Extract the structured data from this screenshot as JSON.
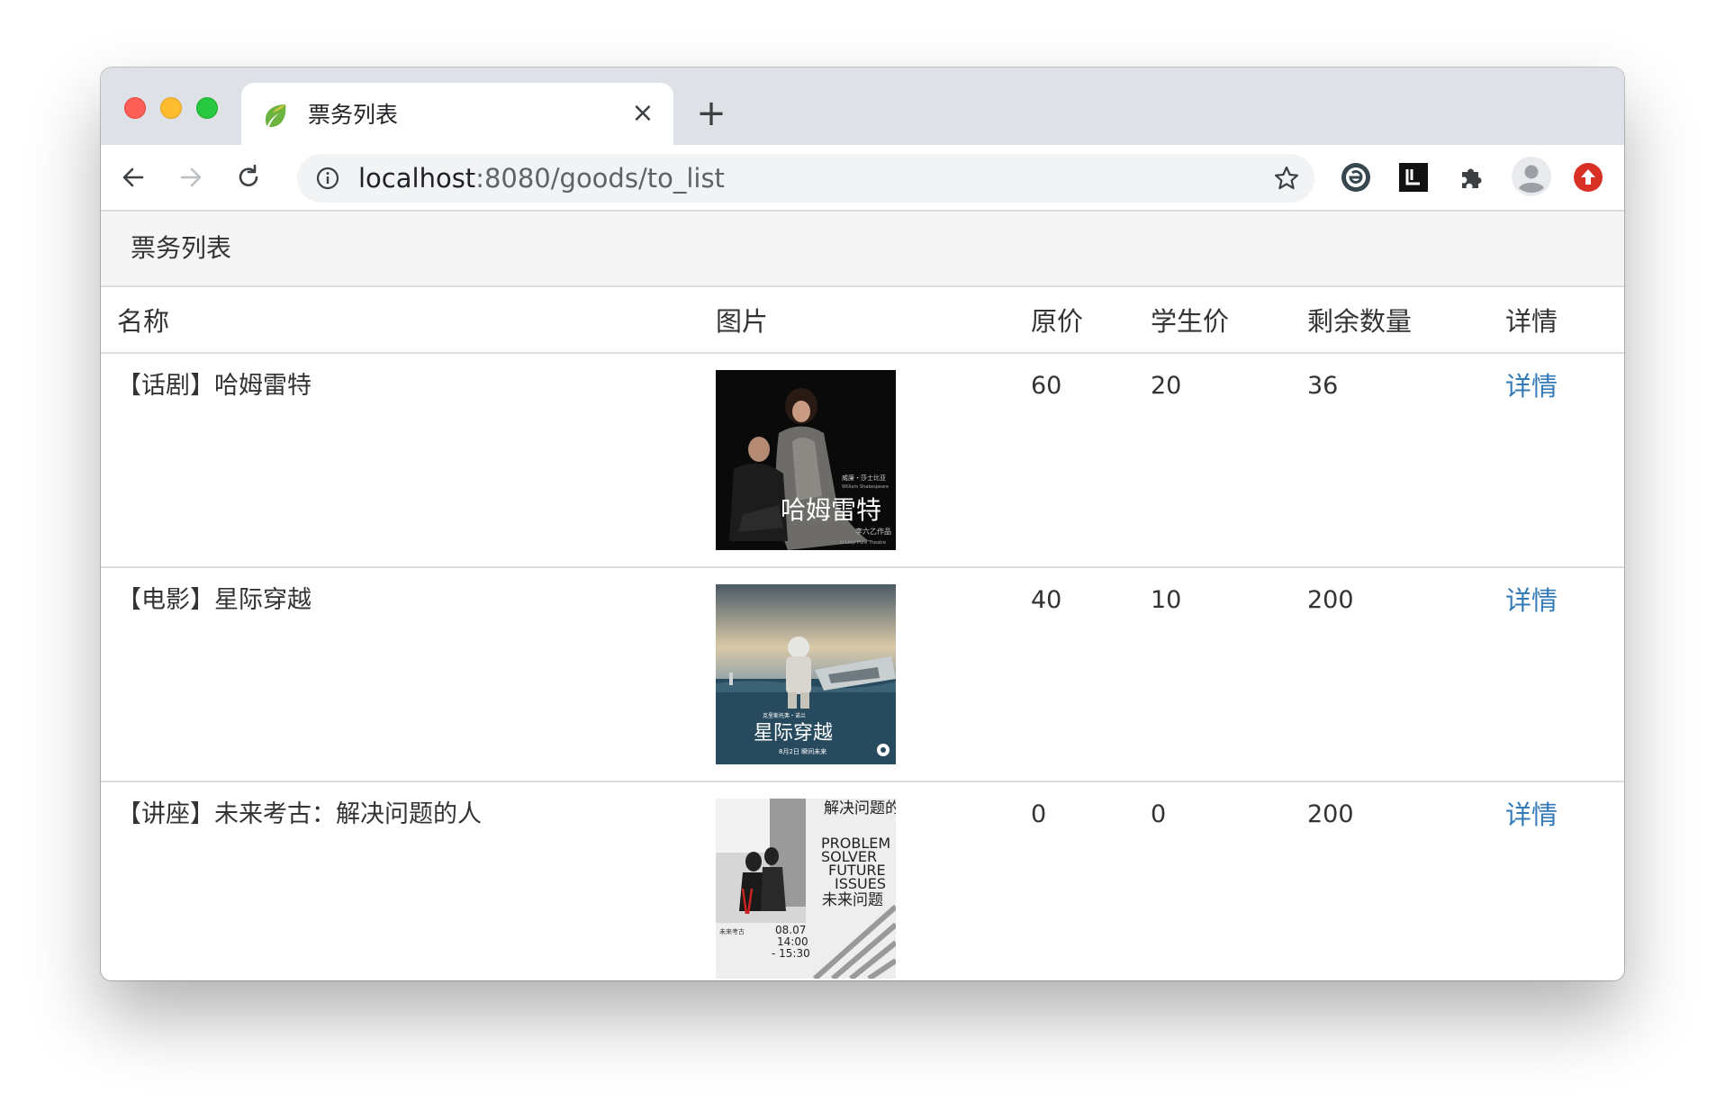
{
  "browser": {
    "tab_title": "票务列表",
    "url_host": "localhost",
    "url_rest": ":8080/goods/to_list"
  },
  "page": {
    "heading": "票务列表",
    "table": {
      "headers": [
        "名称",
        "图片",
        "原价",
        "学生价",
        "剩余数量",
        "详情"
      ],
      "rows": [
        {
          "name": "【话剧】哈姆雷特",
          "image_alt": "哈姆雷特",
          "price": "60",
          "student_price": "20",
          "stock": "36",
          "detail": "详情"
        },
        {
          "name": "【电影】星际穿越",
          "image_alt": "星际穿越",
          "price": "40",
          "student_price": "10",
          "stock": "200",
          "detail": "详情"
        },
        {
          "name": "【讲座】未来考古：解决问题的人",
          "image_alt": "解决问题的人",
          "price": "0",
          "student_price": "0",
          "stock": "200",
          "detail": "详情"
        }
      ]
    }
  },
  "posters": {
    "hamlet": {
      "title": "哈姆雷特",
      "author": "William Shakespeare",
      "author_cn": "威廉・莎士比亚",
      "company": "李六乙作品",
      "company_en": "Li Liuyi Pure Theatre"
    },
    "interstellar": {
      "title": "星际穿越",
      "subtitle": "8月2日 瞬间未来",
      "director": "克里斯托弗・诺兰"
    },
    "lecture": {
      "title_cn": "解决问题的人",
      "title_en_1": "PROBLEM",
      "title_en_2": "SOLVER",
      "title_en_3": "FUTURE",
      "title_en_4": "ISSUES",
      "title_tag": "未来问题",
      "date": "08.07",
      "time_start": "14:00",
      "time_end": "- 15:30",
      "series": "未来考古"
    }
  },
  "colors": {
    "link": "#337ab7",
    "panel_bg": "#f5f5f5",
    "tabstrip": "#dee1e6",
    "omnibox": "#f1f3f4"
  }
}
